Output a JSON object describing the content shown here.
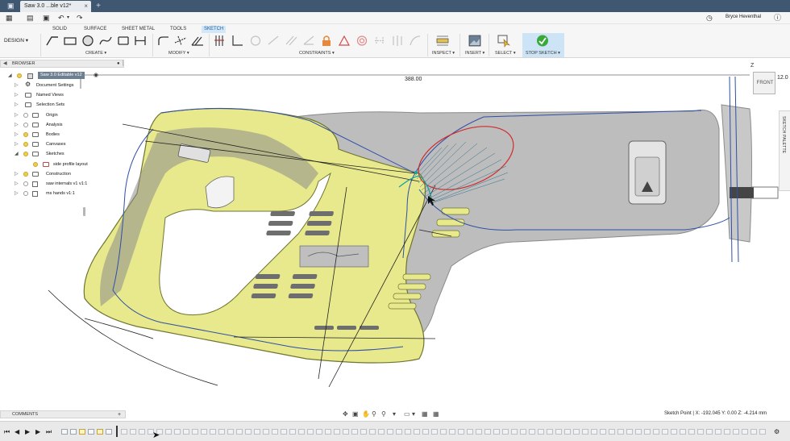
{
  "window": {
    "tab_title": "Saw 3.0 ...ble v12*",
    "tab_close": "×",
    "new_tab": "+",
    "user_name": "Bryce Heventhal"
  },
  "ribbon": {
    "workspace": "DESIGN ▾",
    "tabs": [
      "SOLID",
      "SURFACE",
      "SHEET METAL",
      "TOOLS",
      "SKETCH"
    ],
    "active_tab": "SKETCH",
    "groups": [
      "CREATE ▾",
      "MODIFY ▾",
      "CONSTRAINTS ▾",
      "INSPECT ▾",
      "INSERT ▾",
      "SELECT ▾",
      "STOP SKETCH ▾"
    ]
  },
  "browser": {
    "title": "BROWSER",
    "root": "Saw 3.0 Editable v12",
    "items": [
      {
        "label": "Document Settings",
        "visible": false
      },
      {
        "label": "Named Views",
        "visible": false
      },
      {
        "label": "Selection Sets",
        "visible": false
      },
      {
        "label": "Origin",
        "visible": true
      },
      {
        "label": "Analysis",
        "visible": true
      },
      {
        "label": "Bodies",
        "visible": true
      },
      {
        "label": "Canvases",
        "visible": true
      },
      {
        "label": "Sketches",
        "visible": true
      },
      {
        "label": "side profile layout",
        "visible": true
      },
      {
        "label": "Construction",
        "visible": true
      },
      {
        "label": "saw internals v1 v1:1",
        "visible": true
      },
      {
        "label": "ms hands v1:1",
        "visible": true
      }
    ]
  },
  "viewport": {
    "dimension_top": "388.00",
    "dimension_right": "12.0",
    "axis_label": "Z",
    "viewcube_face": "FRONT",
    "palette_label": "SKETCH PALETTE"
  },
  "comments": {
    "title": "COMMENTS",
    "add": "+"
  },
  "status": {
    "text": "Sketch Point | X: -192.045 Y: 0.00 Z: -4.214 mm"
  },
  "colors": {
    "title_bar": "#3f5771",
    "active_tab_bg": "#d3e7f8",
    "stop_sketch_green": "#3aa93a",
    "canvas_yellow": "#e7e98c",
    "sketch_blue": "#2f4fa8",
    "sketch_red": "#d22b2b"
  }
}
